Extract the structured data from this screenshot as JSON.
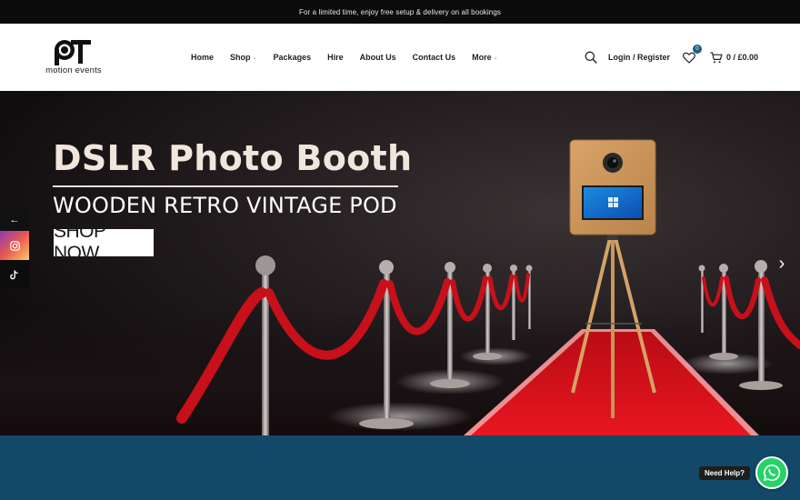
{
  "topbar": {
    "text": "For a limited time, enjoy free setup & delivery on all bookings"
  },
  "logo": {
    "mark": "PT",
    "text": "motion events"
  },
  "nav": {
    "items": [
      {
        "label": "Home",
        "has_caret": false
      },
      {
        "label": "Shop",
        "has_caret": true
      },
      {
        "label": "Packages",
        "has_caret": false
      },
      {
        "label": "Hire",
        "has_caret": false
      },
      {
        "label": "About Us",
        "has_caret": false
      },
      {
        "label": "Contact Us",
        "has_caret": false
      },
      {
        "label": "More",
        "has_caret": true
      }
    ],
    "caret": "⌄"
  },
  "header": {
    "login_label": "Login / Register",
    "wishlist_count": "0",
    "cart_total": "0 / £0.00"
  },
  "hero": {
    "title": "DSLR Photo Booth",
    "subtitle": "WOODEN RETRO VINTAGE POD",
    "button_label": "SHOP NOW",
    "next_arrow": "›"
  },
  "social": {
    "share_glyph": "←"
  },
  "help": {
    "label": "Need Help?"
  },
  "icons": {
    "search": "search-icon",
    "wishlist": "heart-icon",
    "cart": "cart-icon",
    "instagram": "instagram-icon",
    "tiktok": "tiktok-icon",
    "whatsapp": "whatsapp-icon"
  },
  "colors": {
    "topbar": "#0b0b0b",
    "badge": "#1d5d86",
    "section": "#134868",
    "whatsapp": "#25d366",
    "carpet": "#d8101a"
  }
}
